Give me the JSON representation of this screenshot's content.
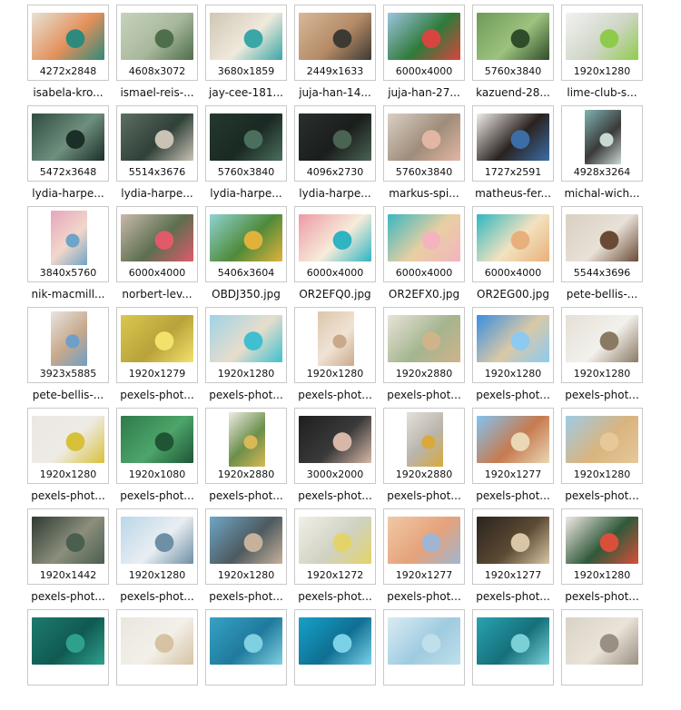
{
  "files": [
    {
      "name": "isabela-kro...",
      "dims": "4272x2848",
      "colors": [
        "#e6e2d6",
        "#2e8a7c",
        "#e3905a"
      ]
    },
    {
      "name": "ismael-reis-...",
      "dims": "4608x3072",
      "colors": [
        "#c7d3bd",
        "#4f6e4a",
        "#a8b89c"
      ]
    },
    {
      "name": "jay-cee-181...",
      "dims": "3680x1859",
      "colors": [
        "#cfc7b4",
        "#3aa6a6",
        "#efe9dc"
      ]
    },
    {
      "name": "juja-han-14...",
      "dims": "2449x1633",
      "colors": [
        "#d6b999",
        "#3d3a34",
        "#b58a66"
      ]
    },
    {
      "name": "juja-han-27...",
      "dims": "6000x4000",
      "colors": [
        "#9cc4df",
        "#d8453f",
        "#2f7a3a"
      ]
    },
    {
      "name": "kazuend-28...",
      "dims": "5760x3840",
      "colors": [
        "#6f9a5a",
        "#2f4d2a",
        "#9cc27e"
      ]
    },
    {
      "name": "lime-club-s...",
      "dims": "1920x1280",
      "colors": [
        "#f2f2f2",
        "#8ecb4d",
        "#cfd6c7"
      ]
    },
    {
      "name": "lydia-harpe...",
      "dims": "5472x3648",
      "colors": [
        "#2f4d40",
        "#1a2f28",
        "#6f8f7e"
      ]
    },
    {
      "name": "lydia-harpe...",
      "dims": "5514x3676",
      "colors": [
        "#5d6f63",
        "#c9c2b5",
        "#2f4138"
      ]
    },
    {
      "name": "lydia-harpe...",
      "dims": "5760x3840",
      "colors": [
        "#24392f",
        "#4b6f5c",
        "#1a2923"
      ]
    },
    {
      "name": "lydia-harpe...",
      "dims": "4096x2730",
      "colors": [
        "#2a302d",
        "#4a6453",
        "#1a1e1c"
      ]
    },
    {
      "name": "markus-spi...",
      "dims": "5760x3840",
      "colors": [
        "#d9d0c4",
        "#e3b6a4",
        "#9f8c7a"
      ]
    },
    {
      "name": "matheus-fer...",
      "dims": "1727x2591",
      "colors": [
        "#f1ede8",
        "#3b6ea6",
        "#2a2220"
      ]
    },
    {
      "name": "michal-wich...",
      "dims": "4928x3264",
      "colors": [
        "#7fb4b2",
        "#c8d9d3",
        "#3a3a3a"
      ]
    },
    {
      "name": "nik-macmill...",
      "dims": "3840x5760",
      "colors": [
        "#e5a6bf",
        "#6fa3c7",
        "#f2d7c9"
      ]
    },
    {
      "name": "norbert-lev...",
      "dims": "6000x4000",
      "colors": [
        "#c9b9a9",
        "#e05a6a",
        "#5c6f4f"
      ]
    },
    {
      "name": "OBDJ350.jpg",
      "dims": "5406x3604",
      "colors": [
        "#8fd3d1",
        "#e0b23b",
        "#4f8a3a"
      ]
    },
    {
      "name": "OR2EFQ0.jpg",
      "dims": "6000x4000",
      "colors": [
        "#ee9aa7",
        "#2fb4c2",
        "#f6ecd9"
      ]
    },
    {
      "name": "OR2EFX0.jpg",
      "dims": "6000x4000",
      "colors": [
        "#3ab7c1",
        "#f3b4bf",
        "#e8cfa2"
      ]
    },
    {
      "name": "OR2EG00.jpg",
      "dims": "6000x4000",
      "colors": [
        "#2fb7bf",
        "#e8b07a",
        "#f3e2c0"
      ]
    },
    {
      "name": "pete-bellis-...",
      "dims": "5544x3696",
      "colors": [
        "#d9cfc2",
        "#6b4a35",
        "#e8e1d7"
      ]
    },
    {
      "name": "pete-bellis-...",
      "dims": "3923x5885",
      "colors": [
        "#e7e5e1",
        "#6e9fc9",
        "#c7a88b"
      ]
    },
    {
      "name": "pexels-phot...",
      "dims": "1920x1279",
      "colors": [
        "#d9c84f",
        "#f2e26b",
        "#b9a23a"
      ]
    },
    {
      "name": "pexels-phot...",
      "dims": "1920x1280",
      "colors": [
        "#9fd3e6",
        "#40bfd0",
        "#e7ddcc"
      ]
    },
    {
      "name": "pexels-phot...",
      "dims": "1920x1280",
      "colors": [
        "#dcc6ad",
        "#c9a98b",
        "#f0e3d4"
      ]
    },
    {
      "name": "pexels-phot...",
      "dims": "1920x2880",
      "colors": [
        "#e9e3d9",
        "#cfb38a",
        "#a4b58f"
      ]
    },
    {
      "name": "pexels-phot...",
      "dims": "1920x1280",
      "colors": [
        "#3a8ee0",
        "#8ccaf2",
        "#d9c9a7"
      ]
    },
    {
      "name": "pexels-phot...",
      "dims": "1920x1280",
      "colors": [
        "#e4e0d7",
        "#8a7a63",
        "#f3f1ec"
      ]
    },
    {
      "name": "pexels-phot...",
      "dims": "1920x1280",
      "colors": [
        "#ebe8e4",
        "#d7c13b",
        "#eeeae4"
      ]
    },
    {
      "name": "pexels-phot...",
      "dims": "1920x1080",
      "colors": [
        "#2f7a4a",
        "#1f5535",
        "#4da56a"
      ]
    },
    {
      "name": "pexels-phot...",
      "dims": "1920x2880",
      "colors": [
        "#eeebe6",
        "#d9b856",
        "#6c8f4a"
      ]
    },
    {
      "name": "pexels-phot...",
      "dims": "3000x2000",
      "colors": [
        "#1f1f1f",
        "#d7b8a8",
        "#3a3a3a"
      ]
    },
    {
      "name": "pexels-phot...",
      "dims": "1920x2880",
      "colors": [
        "#e3e0da",
        "#d9a93a",
        "#b9b4aa"
      ]
    },
    {
      "name": "pexels-phot...",
      "dims": "1920x1277",
      "colors": [
        "#83c3f0",
        "#e9d7b6",
        "#c77a4f"
      ]
    },
    {
      "name": "pexels-phot...",
      "dims": "1920x1280",
      "colors": [
        "#9fcbe6",
        "#e7c899",
        "#d9b47e"
      ]
    },
    {
      "name": "pexels-phot...",
      "dims": "1920x1442",
      "colors": [
        "#2f3a33",
        "#4b5f51",
        "#8b8f7b"
      ]
    },
    {
      "name": "pexels-phot...",
      "dims": "1920x1280",
      "colors": [
        "#b9d7e8",
        "#6f8fa6",
        "#e9eef2"
      ]
    },
    {
      "name": "pexels-phot...",
      "dims": "1920x1280",
      "colors": [
        "#6fa6c7",
        "#c7b19a",
        "#4d5a5f"
      ]
    },
    {
      "name": "pexels-phot...",
      "dims": "1920x1272",
      "colors": [
        "#f2efe7",
        "#e4d36a",
        "#cfd2c2"
      ]
    },
    {
      "name": "pexels-phot...",
      "dims": "1920x1277",
      "colors": [
        "#f0c9a6",
        "#9fb6d2",
        "#e5a27a"
      ]
    },
    {
      "name": "pexels-phot...",
      "dims": "1920x1277",
      "colors": [
        "#2a241d",
        "#d9c6a6",
        "#5c4a34"
      ]
    },
    {
      "name": "pexels-phot...",
      "dims": "1920x1280",
      "colors": [
        "#f2e9e6",
        "#d94f3a",
        "#2f5a3a"
      ]
    },
    {
      "name": "",
      "dims": "",
      "colors": [
        "#1f7a6e",
        "#2fa08c",
        "#0f5a52"
      ]
    },
    {
      "name": "",
      "dims": "",
      "colors": [
        "#eae6df",
        "#d6c3a4",
        "#f3f0ea"
      ]
    },
    {
      "name": "",
      "dims": "",
      "colors": [
        "#37a2c4",
        "#7fd0e0",
        "#1f7a9c"
      ]
    },
    {
      "name": "",
      "dims": "",
      "colors": [
        "#17a1c9",
        "#7bd1e8",
        "#0f6f92"
      ]
    },
    {
      "name": "",
      "dims": "",
      "colors": [
        "#d9ecf3",
        "#bfe0ea",
        "#9fcbe0"
      ]
    },
    {
      "name": "",
      "dims": "",
      "colors": [
        "#2aa3b0",
        "#7bd0d8",
        "#14707a"
      ]
    },
    {
      "name": "",
      "dims": "",
      "colors": [
        "#d9d2c7",
        "#9a8f83",
        "#eae3d8"
      ]
    }
  ],
  "portrait_indices": [
    13,
    14,
    21,
    24,
    30,
    32
  ]
}
